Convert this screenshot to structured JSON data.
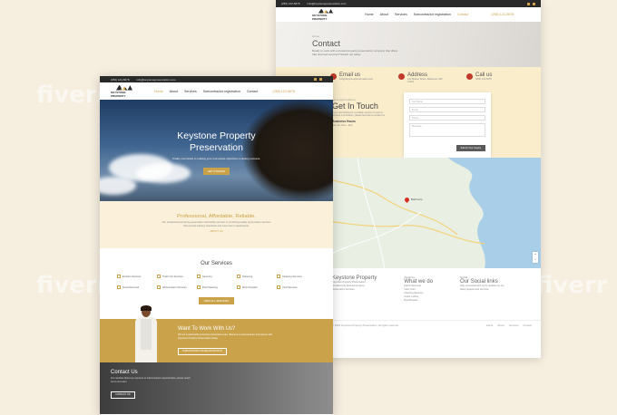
{
  "contact_page": {
    "topbar": {
      "phone": "(256) 123-5678",
      "email": "info@keystonepreservation.com"
    },
    "logo_text": "KEYSTONE PROPERTY",
    "menu": [
      "Home",
      "About",
      "Services",
      "Subcontractor registration",
      "Contact"
    ],
    "phone_link": "(256) 123-5678",
    "hero": {
      "crumb": "Home",
      "title": "Contact",
      "text": "Ready to work with a trusted property preservation company that offers fully licensed services? Reach out today."
    },
    "info": [
      {
        "title": "Email us",
        "text": "info@keystonepreservation.com"
      },
      {
        "title": "Address",
        "text": "123 Market Street, Baltimore, MD 21201"
      },
      {
        "title": "Call us",
        "text": "(256) 123-5678"
      }
    ],
    "touch": {
      "small": "get in touch with us",
      "title": "Get In Touch",
      "desc": "If you are looking for a reliable service or want to become a contractor, please feel free to contact us.",
      "hours_title": "Business Hours",
      "hours": "Mon-Fri, 8am - 6pm"
    },
    "form": {
      "name": "Full Name",
      "email": "Email",
      "phone": "Phone",
      "message": "Message",
      "submit": "Submit Your Inquiry"
    },
    "map_pin_label": "Baltimore",
    "footer": {
      "about_title": "Keystone Property",
      "about_text": "Keystone Property Preservation provides fully licensed property preservation services.",
      "services_small": "Services",
      "services_title": "What we do",
      "services_list": [
        "Debris Removal",
        "Lawn Care",
        "Cleaning Services",
        "Grass Cutting",
        "Roof Repairs"
      ],
      "social_small": "Social",
      "social_title": "Our Social links",
      "social_text": "Stay connected with us for updates on our latest projects and services."
    },
    "copyright": "© 2023 Keystone Property Preservation. All rights reserved.",
    "bottom_links": [
      "Home",
      "About",
      "Services",
      "Contact"
    ]
  },
  "home_page": {
    "topbar": {
      "phone": "(256) 123-5678",
      "email": "info@keystonepreservation.com"
    },
    "logo_text": "KEYSTONE PROPERTY",
    "menu": [
      "Home",
      "About",
      "Services",
      "Subcontractor registration",
      "Contact"
    ],
    "phone_link": "(256) 123-5678",
    "hero": {
      "title_line1": "Keystone Property",
      "title_line2": "Preservation",
      "tagline": "Totally committed to making your real estate objectives a lasting success.",
      "button": "GET STARTED"
    },
    "pro": {
      "title": "Professional, Affordable, Reliable.",
      "text": "Our professional property preservation and facility services is producing quality preservation services that exceed industry standards and meet client requirements.",
      "link": "ABOUT US"
    },
    "services": {
      "title": "Our Services",
      "items": [
        "Eviction Services",
        "Trash Out Services",
        "Securing",
        "Rekeying",
        "Cleaning Services",
        "Snow Removal",
        "Winterization Services",
        "Pool Cleaning",
        "Minor Repairs",
        "Yard Services"
      ],
      "button": "VIEW ALL SERVICES"
    },
    "work": {
      "title": "Want To Work With Us?",
      "text": "We are a nationwide property preservation team. Become a subcontractor and partner with Keystone Property Preservation today.",
      "button": "SUBCONTRACTOR REGISTRATION"
    },
    "contact": {
      "title": "Contact Us",
      "text": "For inquiries about our services or subcontractor opportunities, please reach out to our team.",
      "button": "CONTACT US"
    }
  },
  "colors": {
    "accent": "#c9a24a",
    "dark": "#2a2a2a",
    "cream": "#f6eedf"
  },
  "watermark": "fiverr"
}
